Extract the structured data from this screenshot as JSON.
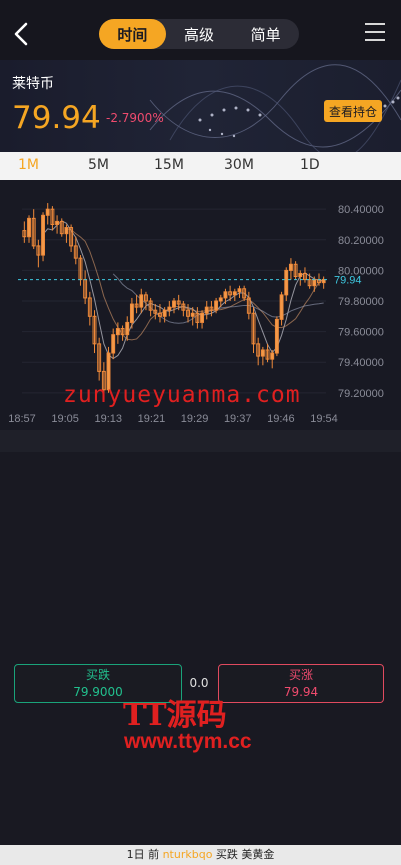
{
  "nav": {
    "tabs": [
      {
        "label": "时间",
        "active": true
      },
      {
        "label": "高级",
        "active": false
      },
      {
        "label": "简单",
        "active": false
      }
    ]
  },
  "banner": {
    "coin_name": "莱特币",
    "price": "79.94",
    "change": "-2.7900%",
    "view_button": "查看持仓"
  },
  "timeframes": [
    "1M",
    "5M",
    "15M",
    "30M",
    "1D"
  ],
  "active_timeframe": "1M",
  "chart_data": {
    "type": "candlestick",
    "x_ticks": [
      "18:57",
      "19:05",
      "19:13",
      "19:21",
      "19:29",
      "19:37",
      "19:46",
      "19:54"
    ],
    "y_ticks": [
      "80.40000",
      "80.20000",
      "80.00000",
      "79.80000",
      "79.60000",
      "79.40000",
      "79.20000"
    ],
    "ylim": [
      79.14,
      80.46
    ],
    "current_price": 79.94,
    "current_price_label": "79.94",
    "candles": [
      [
        80.26,
        80.32,
        80.18,
        80.22
      ],
      [
        80.22,
        80.36,
        80.18,
        80.34
      ],
      [
        80.34,
        80.4,
        80.14,
        80.16
      ],
      [
        80.16,
        80.2,
        80.02,
        80.1
      ],
      [
        80.1,
        80.38,
        80.06,
        80.36
      ],
      [
        80.36,
        80.44,
        80.3,
        80.4
      ],
      [
        80.4,
        80.42,
        80.26,
        80.3
      ],
      [
        80.3,
        80.36,
        80.24,
        80.32
      ],
      [
        80.32,
        80.34,
        80.22,
        80.24
      ],
      [
        80.24,
        80.3,
        80.18,
        80.28
      ],
      [
        80.28,
        80.3,
        80.12,
        80.16
      ],
      [
        80.16,
        80.22,
        80.04,
        80.08
      ],
      [
        80.08,
        80.1,
        79.9,
        79.94
      ],
      [
        79.94,
        80.0,
        79.78,
        79.82
      ],
      [
        79.82,
        79.86,
        79.64,
        79.7
      ],
      [
        79.7,
        79.74,
        79.46,
        79.52
      ],
      [
        79.52,
        79.56,
        79.28,
        79.34
      ],
      [
        79.34,
        79.4,
        79.18,
        79.22
      ],
      [
        79.22,
        79.5,
        79.2,
        79.46
      ],
      [
        79.46,
        79.62,
        79.42,
        79.58
      ],
      [
        79.58,
        79.66,
        79.52,
        79.62
      ],
      [
        79.62,
        79.64,
        79.54,
        79.58
      ],
      [
        79.58,
        79.7,
        79.54,
        79.66
      ],
      [
        79.66,
        79.82,
        79.62,
        79.78
      ],
      [
        79.78,
        79.84,
        79.72,
        79.76
      ],
      [
        79.76,
        79.88,
        79.72,
        79.84
      ],
      [
        79.84,
        79.86,
        79.74,
        79.8
      ],
      [
        79.8,
        79.82,
        79.7,
        79.74
      ],
      [
        79.74,
        79.78,
        79.68,
        79.72
      ],
      [
        79.72,
        79.78,
        79.66,
        79.7
      ],
      [
        79.7,
        79.76,
        79.66,
        79.74
      ],
      [
        79.74,
        79.8,
        79.7,
        79.76
      ],
      [
        79.76,
        79.82,
        79.72,
        79.8
      ],
      [
        79.8,
        79.84,
        79.74,
        79.78
      ],
      [
        79.78,
        79.8,
        79.7,
        79.74
      ],
      [
        79.74,
        79.78,
        79.66,
        79.7
      ],
      [
        79.7,
        79.76,
        79.64,
        79.72
      ],
      [
        79.72,
        79.76,
        79.62,
        79.66
      ],
      [
        79.66,
        79.74,
        79.62,
        79.72
      ],
      [
        79.72,
        79.8,
        79.68,
        79.76
      ],
      [
        79.76,
        79.8,
        79.7,
        79.74
      ],
      [
        79.74,
        79.82,
        79.72,
        79.8
      ],
      [
        79.8,
        79.84,
        79.76,
        79.82
      ],
      [
        79.82,
        79.88,
        79.78,
        79.86
      ],
      [
        79.86,
        79.9,
        79.8,
        79.84
      ],
      [
        79.84,
        79.88,
        79.8,
        79.86
      ],
      [
        79.86,
        79.9,
        79.82,
        79.88
      ],
      [
        79.88,
        79.9,
        79.8,
        79.82
      ],
      [
        79.82,
        79.86,
        79.68,
        79.72
      ],
      [
        79.72,
        79.76,
        79.46,
        79.52
      ],
      [
        79.52,
        79.56,
        79.38,
        79.44
      ],
      [
        79.44,
        79.5,
        79.38,
        79.48
      ],
      [
        79.48,
        79.52,
        79.4,
        79.42
      ],
      [
        79.42,
        79.48,
        79.36,
        79.46
      ],
      [
        79.46,
        79.7,
        79.44,
        79.68
      ],
      [
        79.68,
        79.86,
        79.64,
        79.84
      ],
      [
        79.84,
        80.02,
        79.8,
        80.0
      ],
      [
        80.0,
        80.08,
        79.94,
        80.04
      ],
      [
        80.04,
        80.06,
        79.94,
        79.96
      ],
      [
        79.96,
        80.0,
        79.9,
        79.98
      ],
      [
        79.98,
        80.02,
        79.92,
        79.94
      ],
      [
        79.94,
        79.98,
        79.88,
        79.9
      ],
      [
        79.9,
        79.96,
        79.86,
        79.94
      ],
      [
        79.94,
        79.98,
        79.9,
        79.92
      ],
      [
        79.92,
        79.96,
        79.88,
        79.94
      ]
    ]
  },
  "trade": {
    "sell_label": "买跌",
    "sell_price": "79.9000",
    "mid_value": "0.0",
    "buy_label": "买涨",
    "buy_price": "79.94"
  },
  "watermarks": {
    "site_text": "zunyueyuanma.com",
    "logo_text": "TT源码",
    "logo_url": "www.ttym.cc"
  },
  "footer": {
    "time": "1日 前",
    "user": "nturkbqo",
    "action": "买跌",
    "asset": "美黄金"
  },
  "colors": {
    "accent": "#f5a623",
    "down": "#22c08e",
    "up": "#ef4b6e",
    "current_line": "#3ec8e0"
  }
}
